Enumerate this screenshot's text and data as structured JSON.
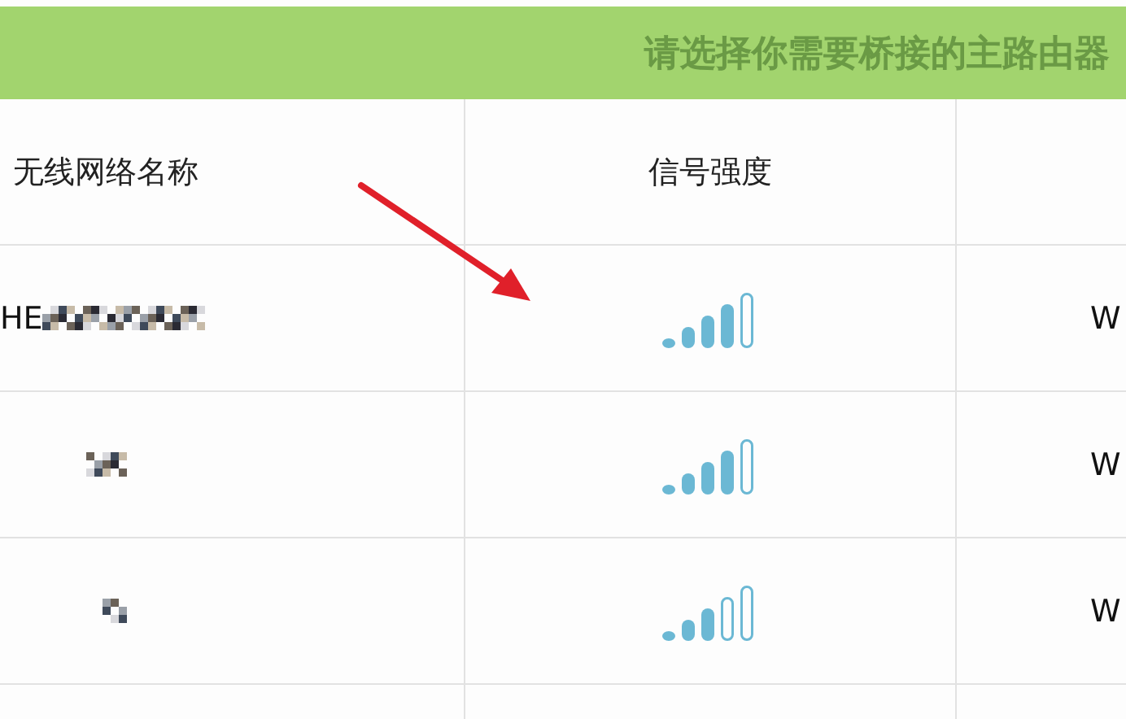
{
  "header": {
    "title": "请选择你需要桥接的主路由器"
  },
  "table": {
    "columns": [
      "无线网络名称",
      "信号强度"
    ],
    "rows": [
      {
        "kind": "strong",
        "name": "HE",
        "redacted": true,
        "column_3": "W"
      },
      {
        "kind": "strong",
        "redacted": true,
        "column_3": "W"
      },
      {
        "kind": "medium",
        "redacted": true,
        "column_3": "W"
      },
      {
        "kind": "blank",
        "redacted": false
      }
    ]
  },
  "annotation": {
    "kind": "arrow"
  }
}
